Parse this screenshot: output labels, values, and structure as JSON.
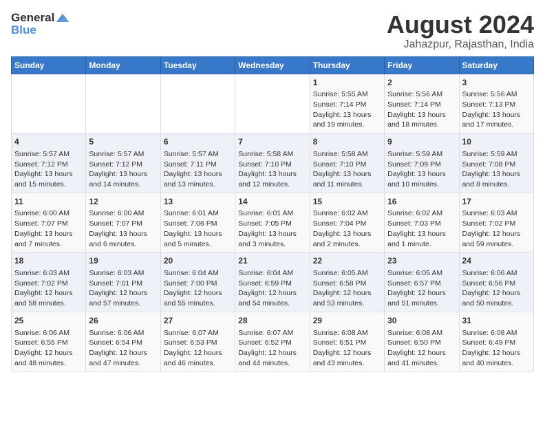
{
  "header": {
    "logo_general": "General",
    "logo_blue": "Blue",
    "month_title": "August 2024",
    "subtitle": "Jahazpur, Rajasthan, India"
  },
  "days_of_week": [
    "Sunday",
    "Monday",
    "Tuesday",
    "Wednesday",
    "Thursday",
    "Friday",
    "Saturday"
  ],
  "weeks": [
    [
      {
        "day": "",
        "data": ""
      },
      {
        "day": "",
        "data": ""
      },
      {
        "day": "",
        "data": ""
      },
      {
        "day": "",
        "data": ""
      },
      {
        "day": "1",
        "data": "Sunrise: 5:55 AM\nSunset: 7:14 PM\nDaylight: 13 hours\nand 19 minutes."
      },
      {
        "day": "2",
        "data": "Sunrise: 5:56 AM\nSunset: 7:14 PM\nDaylight: 13 hours\nand 18 minutes."
      },
      {
        "day": "3",
        "data": "Sunrise: 5:56 AM\nSunset: 7:13 PM\nDaylight: 13 hours\nand 17 minutes."
      }
    ],
    [
      {
        "day": "4",
        "data": "Sunrise: 5:57 AM\nSunset: 7:12 PM\nDaylight: 13 hours\nand 15 minutes."
      },
      {
        "day": "5",
        "data": "Sunrise: 5:57 AM\nSunset: 7:12 PM\nDaylight: 13 hours\nand 14 minutes."
      },
      {
        "day": "6",
        "data": "Sunrise: 5:57 AM\nSunset: 7:11 PM\nDaylight: 13 hours\nand 13 minutes."
      },
      {
        "day": "7",
        "data": "Sunrise: 5:58 AM\nSunset: 7:10 PM\nDaylight: 13 hours\nand 12 minutes."
      },
      {
        "day": "8",
        "data": "Sunrise: 5:58 AM\nSunset: 7:10 PM\nDaylight: 13 hours\nand 11 minutes."
      },
      {
        "day": "9",
        "data": "Sunrise: 5:59 AM\nSunset: 7:09 PM\nDaylight: 13 hours\nand 10 minutes."
      },
      {
        "day": "10",
        "data": "Sunrise: 5:59 AM\nSunset: 7:08 PM\nDaylight: 13 hours\nand 8 minutes."
      }
    ],
    [
      {
        "day": "11",
        "data": "Sunrise: 6:00 AM\nSunset: 7:07 PM\nDaylight: 13 hours\nand 7 minutes."
      },
      {
        "day": "12",
        "data": "Sunrise: 6:00 AM\nSunset: 7:07 PM\nDaylight: 13 hours\nand 6 minutes."
      },
      {
        "day": "13",
        "data": "Sunrise: 6:01 AM\nSunset: 7:06 PM\nDaylight: 13 hours\nand 5 minutes."
      },
      {
        "day": "14",
        "data": "Sunrise: 6:01 AM\nSunset: 7:05 PM\nDaylight: 13 hours\nand 3 minutes."
      },
      {
        "day": "15",
        "data": "Sunrise: 6:02 AM\nSunset: 7:04 PM\nDaylight: 13 hours\nand 2 minutes."
      },
      {
        "day": "16",
        "data": "Sunrise: 6:02 AM\nSunset: 7:03 PM\nDaylight: 13 hours\nand 1 minute."
      },
      {
        "day": "17",
        "data": "Sunrise: 6:03 AM\nSunset: 7:02 PM\nDaylight: 12 hours\nand 59 minutes."
      }
    ],
    [
      {
        "day": "18",
        "data": "Sunrise: 6:03 AM\nSunset: 7:02 PM\nDaylight: 12 hours\nand 58 minutes."
      },
      {
        "day": "19",
        "data": "Sunrise: 6:03 AM\nSunset: 7:01 PM\nDaylight: 12 hours\nand 57 minutes."
      },
      {
        "day": "20",
        "data": "Sunrise: 6:04 AM\nSunset: 7:00 PM\nDaylight: 12 hours\nand 55 minutes."
      },
      {
        "day": "21",
        "data": "Sunrise: 6:04 AM\nSunset: 6:59 PM\nDaylight: 12 hours\nand 54 minutes."
      },
      {
        "day": "22",
        "data": "Sunrise: 6:05 AM\nSunset: 6:58 PM\nDaylight: 12 hours\nand 53 minutes."
      },
      {
        "day": "23",
        "data": "Sunrise: 6:05 AM\nSunset: 6:57 PM\nDaylight: 12 hours\nand 51 minutes."
      },
      {
        "day": "24",
        "data": "Sunrise: 6:06 AM\nSunset: 6:56 PM\nDaylight: 12 hours\nand 50 minutes."
      }
    ],
    [
      {
        "day": "25",
        "data": "Sunrise: 6:06 AM\nSunset: 6:55 PM\nDaylight: 12 hours\nand 48 minutes."
      },
      {
        "day": "26",
        "data": "Sunrise: 6:06 AM\nSunset: 6:54 PM\nDaylight: 12 hours\nand 47 minutes."
      },
      {
        "day": "27",
        "data": "Sunrise: 6:07 AM\nSunset: 6:53 PM\nDaylight: 12 hours\nand 46 minutes."
      },
      {
        "day": "28",
        "data": "Sunrise: 6:07 AM\nSunset: 6:52 PM\nDaylight: 12 hours\nand 44 minutes."
      },
      {
        "day": "29",
        "data": "Sunrise: 6:08 AM\nSunset: 6:51 PM\nDaylight: 12 hours\nand 43 minutes."
      },
      {
        "day": "30",
        "data": "Sunrise: 6:08 AM\nSunset: 6:50 PM\nDaylight: 12 hours\nand 41 minutes."
      },
      {
        "day": "31",
        "data": "Sunrise: 6:08 AM\nSunset: 6:49 PM\nDaylight: 12 hours\nand 40 minutes."
      }
    ]
  ]
}
